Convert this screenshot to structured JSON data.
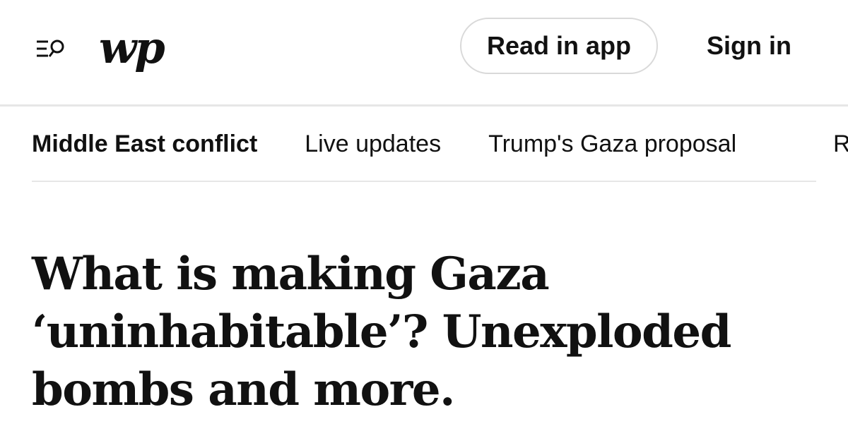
{
  "header": {
    "logo_text": "wp",
    "menu_icon": "menu-search-icon",
    "read_in_app_label": "Read in app",
    "sign_in_label": "Sign in"
  },
  "subnav": {
    "items": [
      {
        "label": "Middle East conflict",
        "active": true
      },
      {
        "label": "Live updates",
        "active": false
      },
      {
        "label": "Trump's Gaza proposal",
        "active": false
      },
      {
        "label": "R",
        "active": false
      }
    ]
  },
  "article": {
    "headline": "What is making Gaza ‘uninhabitable’? Unexploded bombs and more."
  },
  "colors": {
    "text": "#111111",
    "divider": "#e6e6e6",
    "button_border": "#d9d9d9",
    "background": "#ffffff"
  }
}
